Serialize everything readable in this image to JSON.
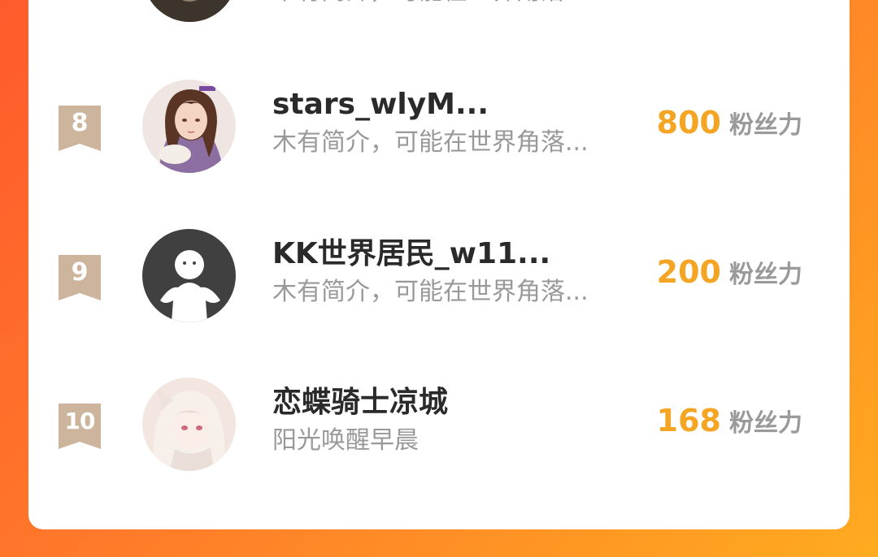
{
  "colors": {
    "rank_badge": "#cdb59d",
    "fans_number": "#f5a524",
    "name": "#2a2a2a",
    "desc": "#999999",
    "fans_label": "#9a9a9a"
  },
  "ranking": {
    "rows": [
      {
        "rank": "",
        "name": "",
        "desc": "木有简介，可能在世界角落...",
        "fans": "",
        "fans_label": "",
        "avatar": "partial-photo-avatar"
      },
      {
        "rank": "8",
        "name": "stars_wlyM...",
        "desc": "木有简介，可能在世界角落...",
        "fans": "800",
        "fans_label": "粉丝力",
        "avatar": "anime-girl-avatar"
      },
      {
        "rank": "9",
        "name": "KK世界居民_w11...",
        "desc": "木有简介，可能在世界角落...",
        "fans": "200",
        "fans_label": "粉丝力",
        "avatar": "default-person-avatar"
      },
      {
        "rank": "10",
        "name": "恋蝶骑士凉城",
        "desc": "阳光唤醒早晨",
        "fans": "168",
        "fans_label": "粉丝力",
        "avatar": "anime-white-hair-avatar"
      }
    ]
  }
}
